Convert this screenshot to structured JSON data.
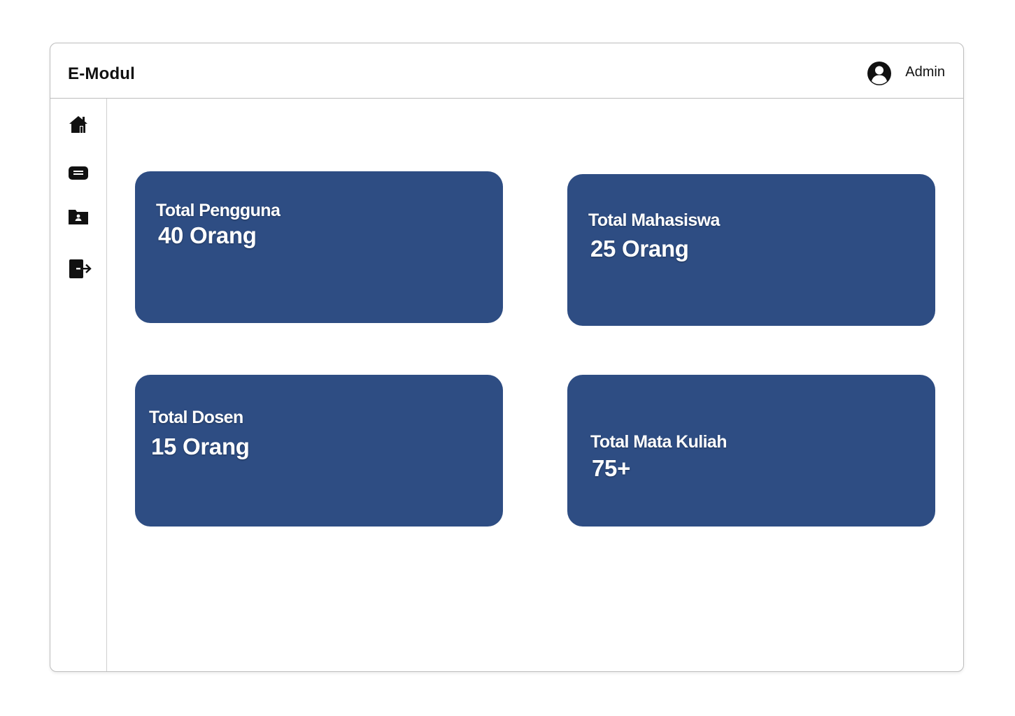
{
  "app": {
    "brand": "E-Modul"
  },
  "header": {
    "user_name": "Admin",
    "avatar_icon": "user-circle-icon"
  },
  "sidebar": {
    "items": [
      {
        "icon": "home-icon"
      },
      {
        "icon": "message-icon"
      },
      {
        "icon": "user-folder-icon"
      },
      {
        "icon": "logout-icon"
      }
    ]
  },
  "stats": [
    {
      "label": "Total Pengguna",
      "value": "40 Orang"
    },
    {
      "label": "Total Mahasiswa",
      "value": "25 Orang"
    },
    {
      "label": "Total Dosen",
      "value": "15 Orang"
    },
    {
      "label": "Total Mata Kuliah",
      "value": "75+"
    }
  ],
  "colors": {
    "card_background": "#2e4d83",
    "card_text": "#ffffff",
    "border": "#bdbdbd"
  }
}
